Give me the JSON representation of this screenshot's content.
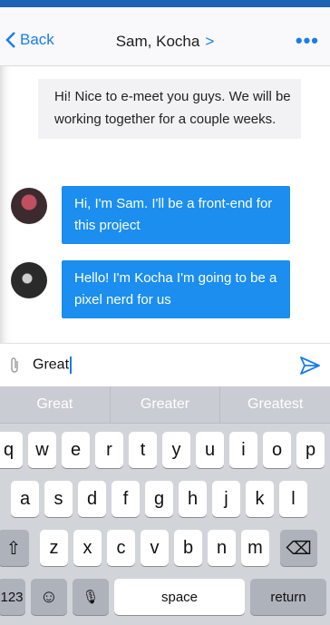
{
  "nav": {
    "back_label": "Back",
    "title": "Sam, Kocha",
    "title_chevron": ">",
    "more": "•••"
  },
  "messages": [
    {
      "sender": "me",
      "text": "Hi! Nice to e-meet you guys. We will be working together for a couple weeks."
    },
    {
      "sender": "Sam",
      "avatar": "sam-avatar",
      "text": "Hi, I'm Sam. I'll be a front-end for this  project"
    },
    {
      "sender": "Kocha",
      "avatar": "kocha-avatar",
      "text": "Hello! I'm Kocha I'm going to be a pixel nerd for us"
    }
  ],
  "composer": {
    "value": "Great",
    "attach_icon": "paperclip-icon",
    "send_icon": "send-icon"
  },
  "keyboard": {
    "suggestions": [
      "Great",
      "Greater",
      "Greatest"
    ],
    "row1": [
      "q",
      "w",
      "e",
      "r",
      "t",
      "y",
      "u",
      "i",
      "o",
      "p"
    ],
    "row2": [
      "a",
      "s",
      "d",
      "f",
      "g",
      "h",
      "j",
      "k",
      "l"
    ],
    "row3": [
      "z",
      "x",
      "c",
      "v",
      "b",
      "n",
      "m"
    ],
    "shift": "⇧",
    "delete": "⌫",
    "numbers": "123",
    "emoji": "☺",
    "mic": "🎙",
    "space": "space",
    "return": "return"
  },
  "colors": {
    "accent": "#1a7cf0",
    "bubble_blue": "#1b8ef0",
    "bubble_grey": "#f2f2f4"
  }
}
